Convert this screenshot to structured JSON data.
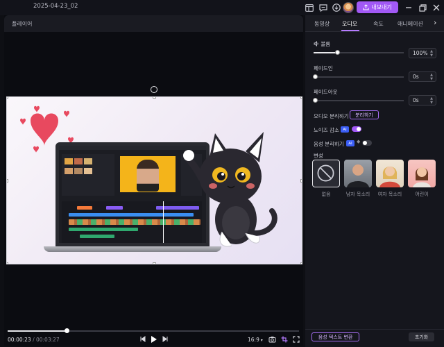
{
  "titlebar": {
    "project_title": "2025-04-23_02",
    "export_label": "내보내기",
    "icons": [
      "layout-icon",
      "feedback-icon",
      "download-icon",
      "avatar",
      "export-icon",
      "minimize-icon",
      "restore-icon",
      "close-icon"
    ]
  },
  "player": {
    "title": "플레이어",
    "current_time": "00:00:23",
    "separator": " / ",
    "total_time": "00:03:27",
    "aspect_ratio": "16:9",
    "progress": 0.2
  },
  "panel": {
    "tabs": [
      {
        "label": "동영상",
        "active": false
      },
      {
        "label": "오디오",
        "active": true
      },
      {
        "label": "속도",
        "active": false
      },
      {
        "label": "애니메이션",
        "active": false
      }
    ],
    "volume_label": "볼륨",
    "volume_value": "100%",
    "volume_level": 0.5,
    "fadein_label": "페이드인",
    "fadein_value": "0s",
    "fadeout_label": "페이드아웃",
    "fadeout_value": "0s",
    "audio_split_label": "오디오 분리하기",
    "audio_split_button": "분리하기",
    "noise_label": "노이즈 감소",
    "voice_split_label": "음성 분리하기",
    "ai_badge": "AI",
    "noise_toggle_on": true,
    "voice_toggle_on": false,
    "voice_change_label": "변성",
    "voices": [
      {
        "label": "없음"
      },
      {
        "label": "남자 목소리"
      },
      {
        "label": "여자 목소리"
      },
      {
        "label": "어린이"
      }
    ],
    "tts_button": "음성 텍스트 변환",
    "reset_button": "초기화"
  },
  "colors": {
    "accent": "#a259f5",
    "ai_badge": "#3b5ef5"
  }
}
